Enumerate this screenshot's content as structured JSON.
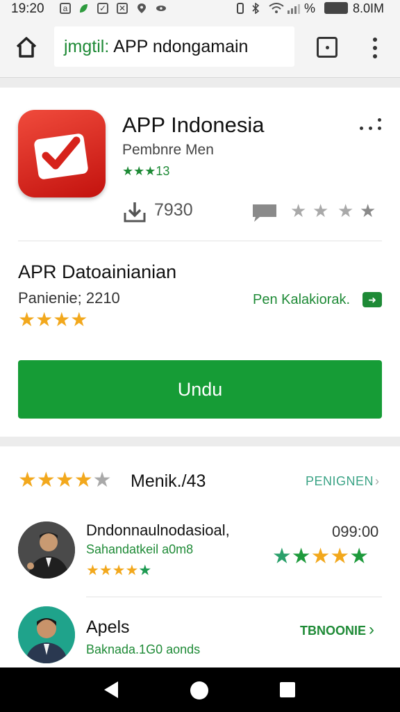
{
  "status_bar": {
    "time": "19:20",
    "percent": "%",
    "right_text": "8.0IM"
  },
  "address_bar": {
    "url_scheme": "jmgtil:",
    "url_text": "APP ndongamain"
  },
  "app": {
    "title": "APP Indonesia",
    "developer": "Pembnre Men",
    "rating_text": "★★★13",
    "download_count": "7930"
  },
  "section": {
    "title": "APR Datoainianian",
    "subtitle": "Panienie; 2210",
    "link_text": "Pen Kalakiorak.",
    "stars": "★★★★"
  },
  "install_button": "Undu",
  "reviews": {
    "header_title": "Menik./43",
    "more_link": "PENIGNEN",
    "items": [
      {
        "name": "Dndonnaulnodasioal,",
        "meta": "Sahandatkeil a0m8",
        "time": "099:00",
        "stars": "★★★★★"
      },
      {
        "name": "Apels",
        "meta": "Baknada.1G0 aonds",
        "action": "TBNOONIE"
      }
    ]
  },
  "colors": {
    "brand_green": "#169c36",
    "star_yellow": "#f2a81d",
    "app_icon_red": "#e0241c"
  }
}
